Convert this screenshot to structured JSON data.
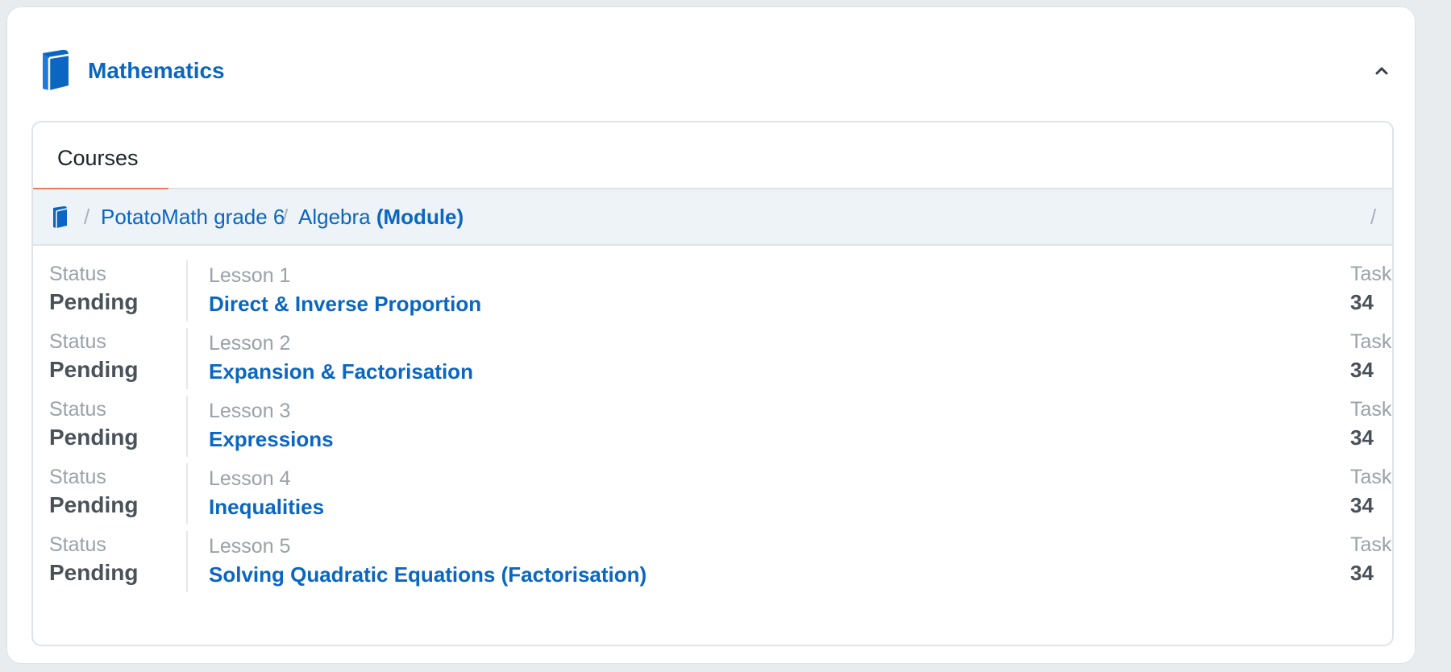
{
  "subject": {
    "title": "Mathematics",
    "icon": "book-icon",
    "collapse_icon": "chevron-up-icon"
  },
  "courses_panel": {
    "tabs": [
      {
        "label": "Courses",
        "active": true
      }
    ],
    "breadcrumb": {
      "home_icon": "book-icon",
      "separator": "/",
      "items": [
        {
          "label": "PotatoMath grade 6"
        },
        {
          "label": "Algebra",
          "suffix": "(Module)"
        }
      ],
      "trailing": "/"
    },
    "lessons": [
      {
        "status_label": "Status",
        "status": "Pending",
        "number": "Lesson 1",
        "title": "Direct & Inverse Proportion",
        "tasks_label": "Tasks",
        "tasks": "34"
      },
      {
        "status_label": "Status",
        "status": "Pending",
        "number": "Lesson 2",
        "title": "Expansion & Factorisation",
        "tasks_label": "Tasks",
        "tasks": "34"
      },
      {
        "status_label": "Status",
        "status": "Pending",
        "number": "Lesson 3",
        "title": "Expressions",
        "tasks_label": "Tasks",
        "tasks": "34"
      },
      {
        "status_label": "Status",
        "status": "Pending",
        "number": "Lesson 4",
        "title": "Inequalities",
        "tasks_label": "Tasks",
        "tasks": "34"
      },
      {
        "status_label": "Status",
        "status": "Pending",
        "number": "Lesson 5",
        "title": "Solving Quadratic Equations (Factorisation)",
        "tasks_label": "Tasks",
        "tasks": "34"
      }
    ]
  },
  "colors": {
    "accent": "#0a66c2",
    "tab_indicator": "#f07d62",
    "breadcrumb_bg": "#eef3f8"
  }
}
